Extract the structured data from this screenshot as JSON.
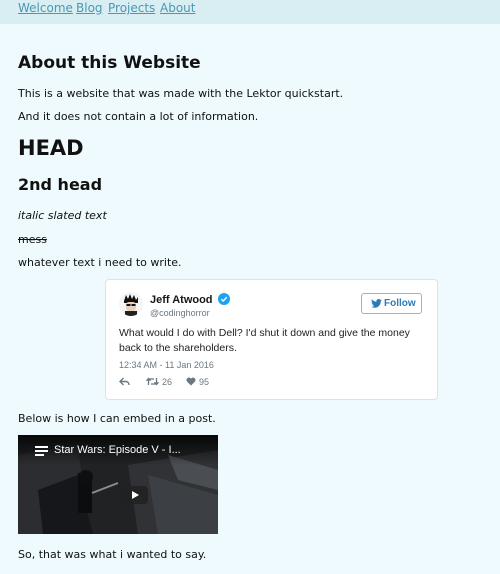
{
  "nav": {
    "items": [
      {
        "label": "Welcome"
      },
      {
        "label": "Blog"
      },
      {
        "label": "Projects"
      },
      {
        "label": "About"
      }
    ]
  },
  "page": {
    "title": "About this Website",
    "intro_1": "This is a website that was made with the Lektor quickstart.",
    "intro_2": "And it does not contain a lot of information.",
    "heading_1": "HEAD",
    "heading_2": "2nd head",
    "italic_text": "italic slated text",
    "strike_text": "mess",
    "plain_text": "whatever text i need to write.",
    "embed_intro": "Below is how I can embed in a post.",
    "closing": "So, that was what i wanted to say."
  },
  "tweet": {
    "author_name": "Jeff Atwood",
    "handle": "@codinghorror",
    "follow_label": "Follow",
    "text": "What would I do with Dell? I'd shut it down and give the money back to the shareholders.",
    "timestamp": "12:34 AM - 11 Jan 2016",
    "retweets": "26",
    "likes": "95",
    "accent_color": "#1da1f2"
  },
  "video": {
    "title": "Star Wars: Episode V - I..."
  },
  "colors": {
    "background": "#eefafd",
    "nav_background": "#d8eef3",
    "link": "#4a98b3"
  }
}
